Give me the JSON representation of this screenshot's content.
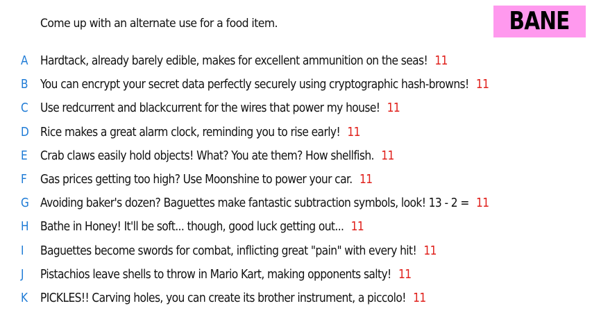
{
  "prompt": "Come up with an alternate use for a food item.",
  "badge": {
    "label": "BANE",
    "color": "#ff99ee"
  },
  "colors": {
    "letter": "#1e7bd6",
    "score": "#e0201b"
  },
  "answers": [
    {
      "letter": "A",
      "text": "Hardtack, already barely edible, makes for excellent ammunition on the seas!",
      "score": "11"
    },
    {
      "letter": "B",
      "text": "You can encrypt your secret data perfectly securely using cryptographic hash-browns!",
      "score": "11"
    },
    {
      "letter": "C",
      "text": "Use redcurrent and blackcurrent for the wires that power my house!",
      "score": "11"
    },
    {
      "letter": "D",
      "text": "Rice makes a great alarm clock, reminding you to rise early!",
      "score": "11"
    },
    {
      "letter": "E",
      "text": "Crab claws easily hold objects! What? You ate them? How shellfish.",
      "score": "11"
    },
    {
      "letter": "F",
      "text": "Gas prices getting too high? Use Moonshine to power your car.",
      "score": "11"
    },
    {
      "letter": "G",
      "text": "Avoiding baker's dozen? Baguettes make fantastic subtraction symbols, look! 13 - 2 =",
      "score": "11"
    },
    {
      "letter": "H",
      "text": "Bathe in Honey! It'll be soft... though, good luck getting out...",
      "score": "11"
    },
    {
      "letter": "I",
      "text": "Baguettes become swords for combat, inflicting great \"pain\" with every hit!",
      "score": "11"
    },
    {
      "letter": "J",
      "text": "Pistachios leave shells to throw in Mario Kart, making opponents salty!",
      "score": "11"
    },
    {
      "letter": "K",
      "text": "PICKLES!! Carving holes, you can create its brother instrument, a piccolo!",
      "score": "11"
    }
  ]
}
